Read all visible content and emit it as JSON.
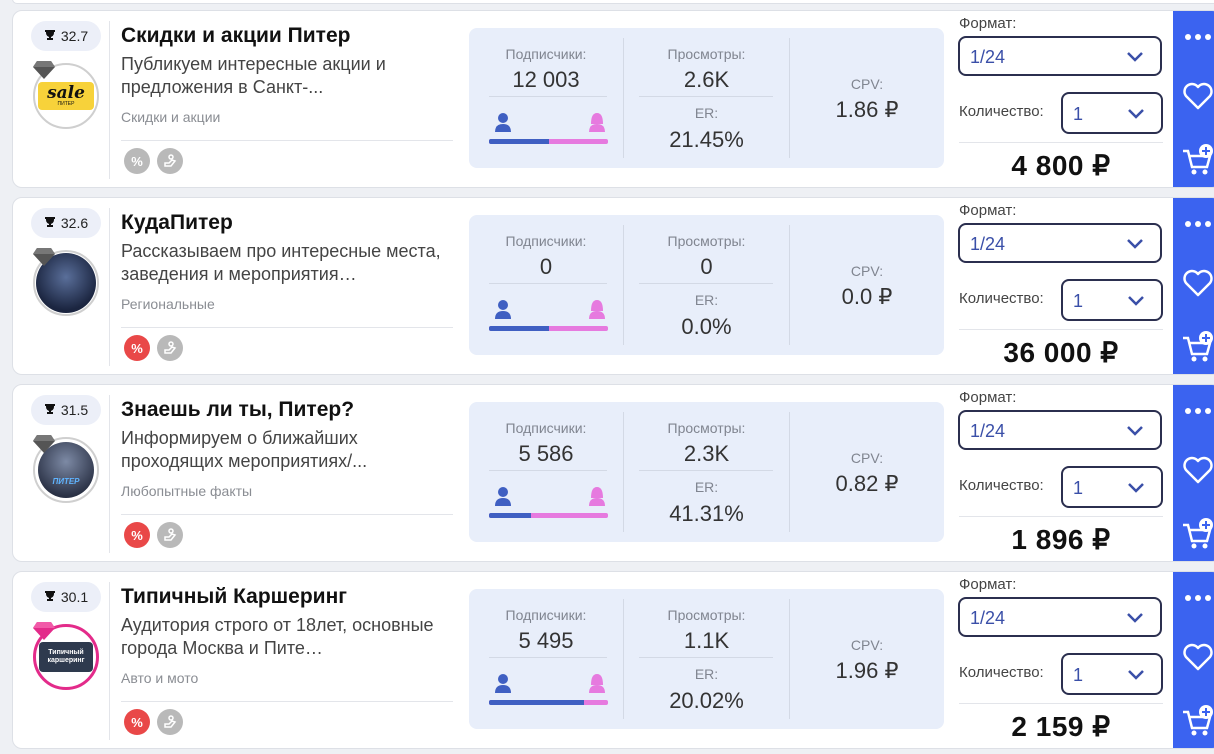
{
  "labels": {
    "subscribers": "Подписчики:",
    "views": "Просмотры:",
    "er": "ER:",
    "cpv": "CPV:",
    "format": "Формат:",
    "quantity": "Количество:"
  },
  "colors": {
    "accent_blue": "#3b63f0",
    "male_blue": "#3f5fc2",
    "female_pink": "#e67adf",
    "badge_red": "#e94848",
    "badge_gray": "#b9b9b9",
    "stats_bg": "#e8eefa"
  },
  "icons": [
    "trophy-icon",
    "diamond-icon",
    "percent-icon",
    "hand-icon",
    "male-icon",
    "female-icon",
    "chevron-down-icon",
    "more-dots-icon",
    "heart-icon",
    "cart-add-icon"
  ],
  "channels": [
    {
      "rating": "32.7",
      "title": "Скидки и акции Питер",
      "description": "Публикуем интересные акции и предложения в Санкт-...",
      "category": "Скидки и акции",
      "avatar_text": "sale",
      "avatar_subtext": "ПИТЕР",
      "percent_badge": "gray",
      "subscribers": "12 003",
      "views": "2.6K",
      "er": "21.45%",
      "cpv": "1.86 ₽",
      "male_share": 0.5,
      "format": "1/24",
      "quantity": "1",
      "price": "4 800 ₽"
    },
    {
      "rating": "32.6",
      "title": "КудаПитер",
      "description": "Рассказываем про интересные места, заведения и мероприятия…",
      "category": "Региональные",
      "avatar_text": "",
      "avatar_subtext": "",
      "percent_badge": "red",
      "subscribers": "0",
      "views": "0",
      "er": "0.0%",
      "cpv": "0.0 ₽",
      "male_share": 0.5,
      "format": "1/24",
      "quantity": "1",
      "price": "36 000 ₽"
    },
    {
      "rating": "31.5",
      "title": "Знаешь ли ты, Питер?",
      "description": "Информируем о ближайших проходящих мероприятиях/...",
      "category": "Любопытные факты",
      "avatar_text": "ПИТЕР",
      "avatar_subtext": "",
      "percent_badge": "red",
      "subscribers": "5 586",
      "views": "2.3K",
      "er": "41.31%",
      "cpv": "0.82 ₽",
      "male_share": 0.35,
      "format": "1/24",
      "quantity": "1",
      "price": "1 896 ₽"
    },
    {
      "rating": "30.1",
      "title": "Типичный Каршеринг",
      "description": "Аудитория строго от 18лет, основные города Москва и Пите…",
      "category": "Авто и мото",
      "avatar_text": "Типичный",
      "avatar_subtext": "каршеринг",
      "percent_badge": "red",
      "subscribers": "5 495",
      "views": "1.1K",
      "er": "20.02%",
      "cpv": "1.96 ₽",
      "male_share": 0.8,
      "format": "1/24",
      "quantity": "1",
      "price": "2 159 ₽"
    }
  ]
}
